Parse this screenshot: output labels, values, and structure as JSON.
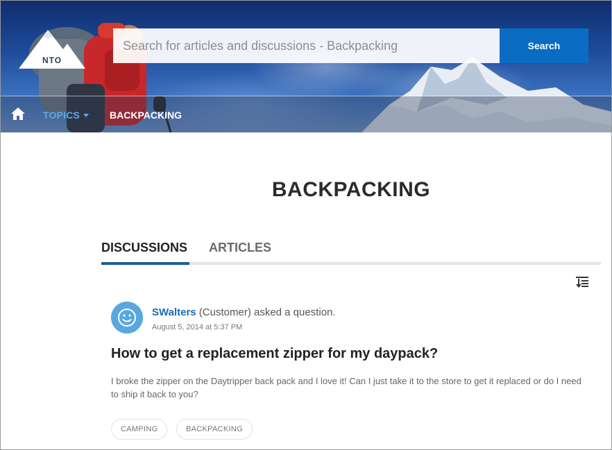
{
  "header": {
    "logo_text": "NTO",
    "search": {
      "placeholder": "Search for articles and discussions - Backpacking",
      "value": ""
    },
    "search_button_label": "Search"
  },
  "nav": {
    "home_icon": "home-icon",
    "topics_label": "TOPICS",
    "current_topic": "BACKPACKING"
  },
  "page": {
    "title": "BACKPACKING",
    "tabs": [
      {
        "label": "DISCUSSIONS",
        "active": true
      },
      {
        "label": "ARTICLES",
        "active": false
      }
    ],
    "sort_icon": "sort-icon"
  },
  "feed": {
    "items": [
      {
        "author": "SWalters",
        "role_text": " (Customer) asked a question.",
        "timestamp": "August 5, 2014 at 5:37 PM",
        "title": "How to get a replacement zipper for my daypack?",
        "body": "I broke the zipper on the Daytripper back pack and I love it! Can I just take it to the store to get it replaced or do I need to ship it back to you?",
        "tags": [
          "CAMPING",
          "BACKPACKING"
        ]
      }
    ]
  },
  "colors": {
    "accent": "#0a6cc2",
    "nav_link": "#5fa8e8",
    "author_link": "#1b6bb3",
    "avatar": "#5aa7df",
    "tab_active": "#1b5f99"
  }
}
